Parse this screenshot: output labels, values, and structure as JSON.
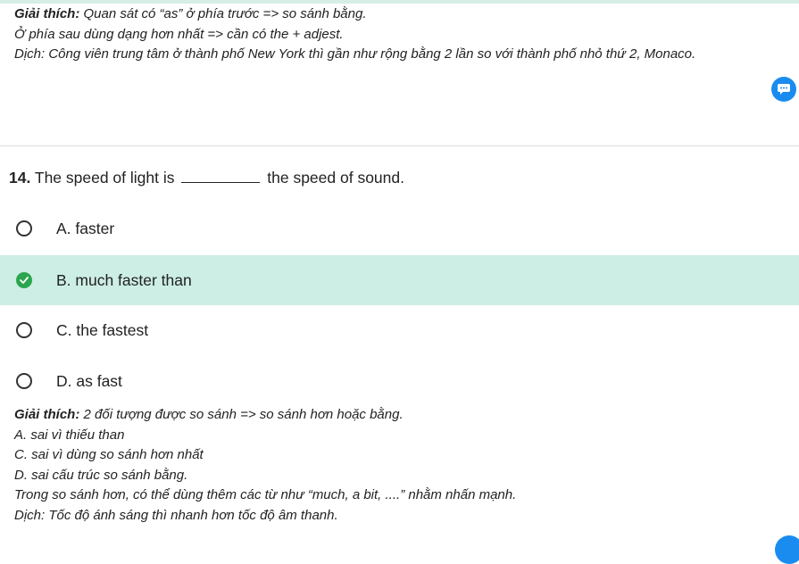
{
  "previous_explanation": {
    "heading": "Giải thích:",
    "line1_rest": " Quan sát có “as” ở phía trước => so sánh bằng.",
    "line2": "Ở phía sau dùng dạng hơn nhất => cần có the + adjest.",
    "line3": "Dịch: Công viên trung tâm ở thành phố New York thì gần như rộng bằng 2 lần so với thành phố nhỏ thứ 2, Monaco."
  },
  "question": {
    "number": "14.",
    "text_before": "The speed of light is",
    "text_after": "the speed of sound."
  },
  "options": [
    {
      "label": "A. faster",
      "selected": false
    },
    {
      "label": "B. much faster than",
      "selected": true
    },
    {
      "label": "C. the fastest",
      "selected": false
    },
    {
      "label": "D. as fast",
      "selected": false
    }
  ],
  "explanation": {
    "heading": "Giải thích:",
    "line1_rest": " 2 đối tượng được so sánh => so sánh hơn hoặc bằng.",
    "lines": [
      "A. sai vì thiếu than",
      "C. sai vì dùng so sánh hơn nhất",
      "D. sai cấu trúc so sánh bằng.",
      "Trong so sánh hơn, có thể dùng thêm các từ như “much, a bit, ....” nhằm nhấn mạnh.",
      "Dịch: Tốc độ ánh sáng thì nhanh hơn tốc độ âm thanh."
    ]
  },
  "icons": {
    "chat": "chat-bubble-icon",
    "correct": "check-circle-icon",
    "radio": "radio-empty-icon"
  },
  "colors": {
    "selected_bg": "#cdeee4",
    "check_green": "#2ba54e",
    "chat_blue": "#1a8cf0"
  }
}
